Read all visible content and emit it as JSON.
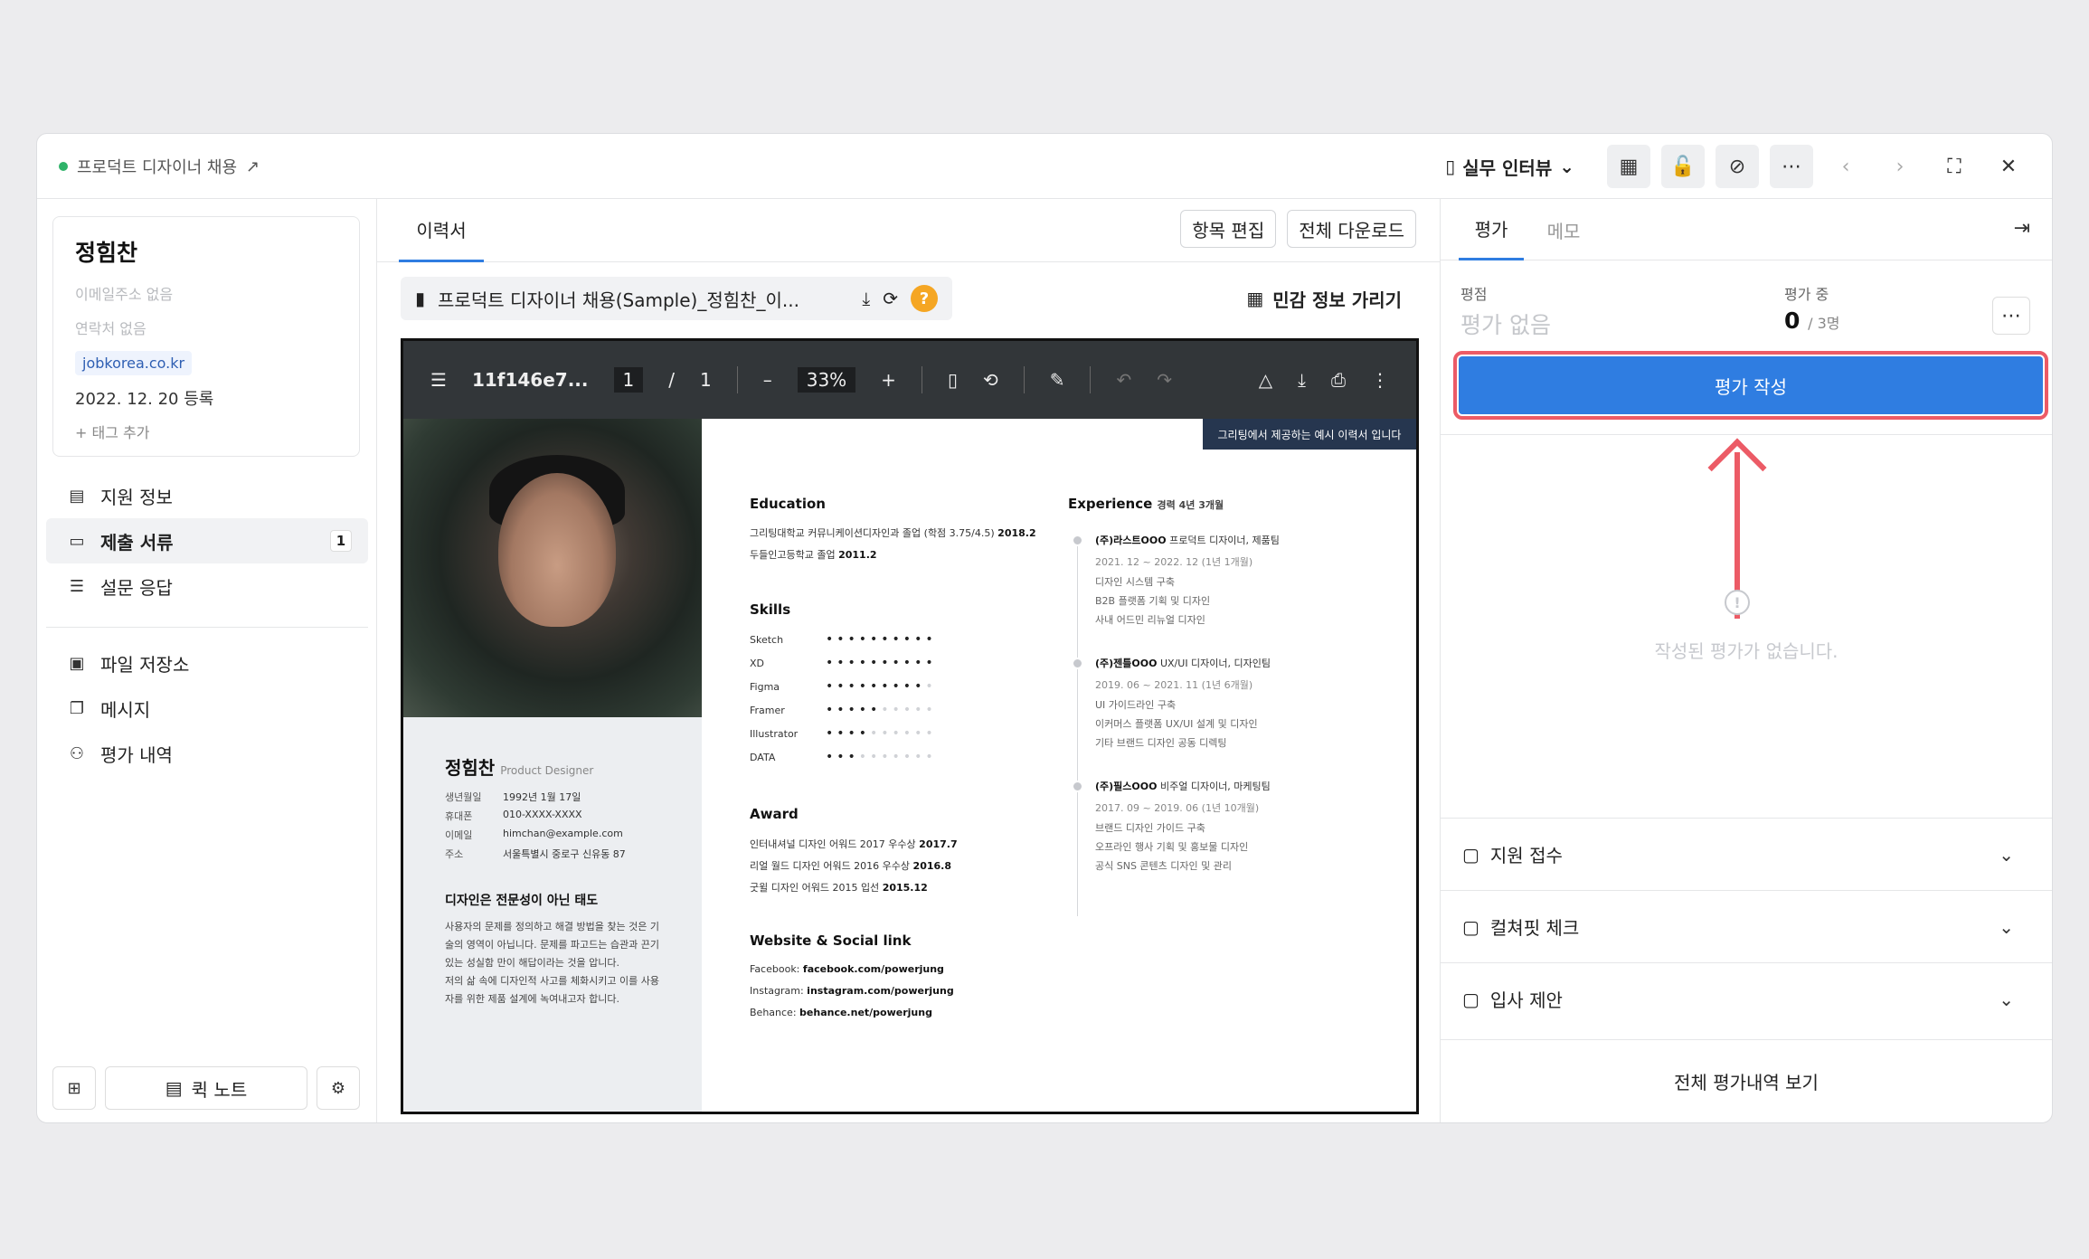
{
  "header": {
    "job_title": "프로덕트 디자이너 채용",
    "stage": "실무 인터뷰"
  },
  "candidate": {
    "name": "정힘찬",
    "email": "이메일주소 없음",
    "phone": "연락처 없음",
    "source": "jobkorea.co.kr",
    "registered": "2022. 12. 20 등록",
    "add_tag": "+ 태그 추가"
  },
  "nav": {
    "items": [
      {
        "label": "지원 정보"
      },
      {
        "label": "제출 서류",
        "badge": "1"
      },
      {
        "label": "설문 응답"
      }
    ],
    "items2": [
      {
        "label": "파일 저장소"
      },
      {
        "label": "메시지"
      },
      {
        "label": "평가 내역"
      }
    ],
    "quick_note": "퀵 노트"
  },
  "center": {
    "tab": "이력서",
    "edit_items": "항목 편집",
    "download_all": "전체 다운로드",
    "file_name": "프로덕트 디자이너 채용(Sample)_정힘찬_이...",
    "hide_sensitive": "민감 정보 가리기"
  },
  "viewer": {
    "doc_name": "11f146e7...",
    "page_current": "1",
    "page_sep": "/",
    "page_total": "1",
    "zoom": "33%",
    "minus": "–",
    "plus": "+"
  },
  "resume": {
    "banner": "그리팅에서 제공하는 예시 이력서 입니다",
    "name": "정힘찬",
    "role": "Product Designer",
    "profile": [
      {
        "k": "생년월일",
        "v": "1992년 1월 17일"
      },
      {
        "k": "휴대폰",
        "v": "010-XXXX-XXXX"
      },
      {
        "k": "이메일",
        "v": "himchan@example.com"
      },
      {
        "k": "주소",
        "v": "서울특별시 중로구 신유동 87"
      }
    ],
    "motto_title": "디자인은 전문성이 아닌 태도",
    "motto_lines": [
      "사용자의 문제를 정의하고 해결 방법을 찾는 것은 기",
      "술의 영역이 아닙니다. 문제를 파고드는 습관과 끈기",
      "있는 성실함 만이 해답이라는 것을 압니다.",
      "저의 삶 속에 디자인적 사고를 체화시키고 이를 사용",
      "자를 위한 제품 설계에 녹여내고자 합니다."
    ],
    "education_title": "Education",
    "education": [
      {
        "text": "그리팅대학교 커뮤니케이션디자인과 졸업 (학점 3.75/4.5)",
        "year": "2018.2"
      },
      {
        "text": "두들인고등학교 졸업",
        "year": "2011.2"
      }
    ],
    "skills_title": "Skills",
    "skills": [
      {
        "name": "Sketch",
        "level": 10
      },
      {
        "name": "XD",
        "level": 10
      },
      {
        "name": "Figma",
        "level": 9
      },
      {
        "name": "Framer",
        "level": 5
      },
      {
        "name": "Illustrator",
        "level": 4
      },
      {
        "name": "DATA",
        "level": 3
      }
    ],
    "award_title": "Award",
    "awards": [
      {
        "text": "인터내셔널 디자인 어워드 2017 우수상",
        "year": "2017.7"
      },
      {
        "text": "리얼 월드 디자인 어워드 2016 우수상",
        "year": "2016.8"
      },
      {
        "text": "굿윌 디자인 어워드 2015 입선",
        "year": "2015.12"
      }
    ],
    "web_title": "Website & Social link",
    "links": [
      {
        "k": "Facebook:",
        "v": "facebook.com/powerjung"
      },
      {
        "k": "Instagram:",
        "v": "instagram.com/powerjung"
      },
      {
        "k": "Behance:",
        "v": "behance.net/powerjung"
      }
    ],
    "exp_title": "Experience",
    "exp_total": "경력 4년 3개월",
    "experiences": [
      {
        "company": "(주)라스트OOO",
        "role": "프로덕트 디자이너, 제품팀",
        "period": "2021. 12 ~ 2022. 12 (1년 1개월)",
        "tasks": [
          "디자인 시스템 구축",
          "B2B 플랫폼 기획 및 디자인",
          "사내 어드민 리뉴얼 디자인"
        ]
      },
      {
        "company": "(주)젠틀OOO",
        "role": "UX/UI 디자이너, 디자인팀",
        "period": "2019. 06 ~ 2021. 11 (1년 6개월)",
        "tasks": [
          "UI 가이드라인 구축",
          "이커머스 플랫폼 UX/UI 설계 및 디자인",
          "기타 브랜드 디자인 공동 디렉팅"
        ]
      },
      {
        "company": "(주)필스OOO",
        "role": "비주얼 디자이너, 마케팅팀",
        "period": "2017. 09 ~ 2019. 06 (1년 10개월)",
        "tasks": [
          "브랜드 디자인 가이드 구축",
          "오프라인 행사 기획 및 홍보물 디자인",
          "공식 SNS 콘텐츠 디자인 및 관리"
        ]
      }
    ]
  },
  "right": {
    "tab_eval": "평가",
    "tab_memo": "메모",
    "score_label": "평점",
    "score_value": "평가 없음",
    "progress_label": "평가 중",
    "progress_count": "0",
    "progress_total": "/ 3명",
    "write_eval": "평가 작성",
    "empty_text": "작성된 평가가 없습니다.",
    "sections": [
      "지원 접수",
      "컬쳐핏 체크",
      "입사 제안"
    ],
    "view_all": "전체 평가내역 보기"
  },
  "colors": {
    "accent": "#2f7de1",
    "highlight": "#ec5b66",
    "status_dot": "#2fb369"
  }
}
